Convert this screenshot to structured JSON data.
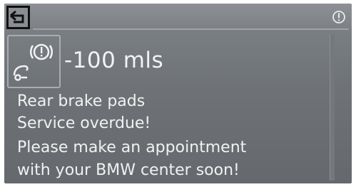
{
  "header": {
    "back_icon": "back-arrow-icon",
    "warning_icon": "exclamation-circle-icon"
  },
  "status": {
    "icon": "brake-pad-warning-icon",
    "distance": "-100 mls"
  },
  "message": {
    "lines": [
      "Rear brake pads",
      "Service overdue!",
      "Please make an appointment",
      "with your BMW center soon!"
    ]
  },
  "colors": {
    "screen_bg": "#6f7377",
    "text": "#f1f1f1",
    "back_frame": "#111111"
  }
}
